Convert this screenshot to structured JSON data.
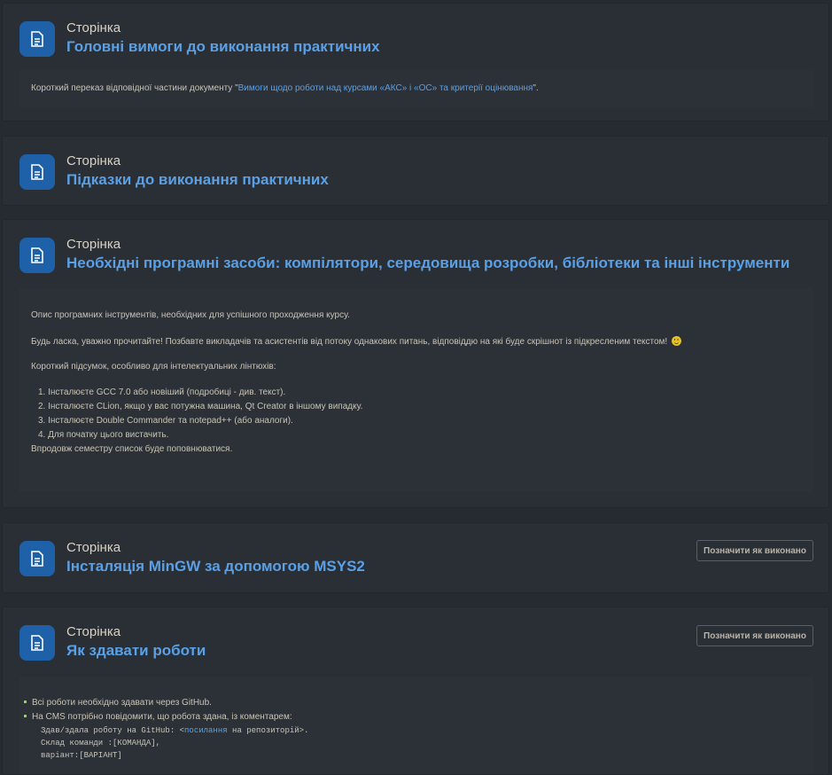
{
  "activities": [
    {
      "kind": "Сторінка",
      "title": "Головні вимоги до виконання практичних",
      "desc_prefix": "Короткий переказ відповідної частини документу \"",
      "desc_link": "Вимоги щодо роботи над курсами «АКС» і «ОС» та критерії оцінювання",
      "desc_suffix": "\"."
    },
    {
      "kind": "Сторінка",
      "title": "Підказки до виконання практичних"
    },
    {
      "kind": "Сторінка",
      "title": "Необхідні програмні засоби: компілятори, середовища розробки, бібліотеки та інші інструменти",
      "desc_lines": [
        "Опис програмних інструментів, необхідних для успішного проходження курсу.",
        "Будь ласка, уважно прочитайте! Позбавте викладачів та асистентів від потоку однакових питань, відповіддю на які буде скрішнот із підкресленим текстом!",
        "Короткий підсумок, особливо для інтелектуальних лінтюхів:"
      ],
      "list": [
        "1. Інсталюєте GCC 7.0 або новіший (подробиці - див. текст).",
        "2. Інсталюєте CLion, якщо у вас потужна машина, Qt Creator в іншому випадку.",
        "3. Інсталюєте Double Commander та notepad++ (або аналоги).",
        "4. Для початку цього вистачить."
      ],
      "footer": "Впродовж семестру список буде поповнюватися."
    },
    {
      "kind": "Сторінка",
      "title": "Інсталяція MinGW за допомогою MSYS2",
      "button": "Позначити як виконано"
    },
    {
      "kind": "Сторінка",
      "title": "Як здавати роботи",
      "button": "Позначити як виконано",
      "bullets": [
        "Всі роботи необхідно здавати через GitHub.",
        "На CMS потрібно повідомити, що робота здана, із коментарем:"
      ],
      "code_prefix": "Здав/здала роботу на GitHub: <",
      "code_link": "посилання",
      "code_suffix": " на репозиторій>.",
      "code_lines": [
        "Склад команди :[КОМАНДА],",
        "варіант:[ВАРІАНТ]"
      ]
    }
  ],
  "icon": "page-document-icon",
  "colors": {
    "accent": "#5aa0e6",
    "icon_bg": "#1e61a8",
    "bg": "#262b31"
  }
}
